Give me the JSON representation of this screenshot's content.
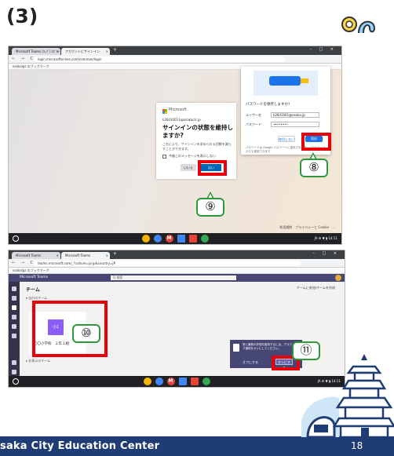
{
  "step_number": "(3)",
  "screenshot1": {
    "tabs": [
      "Microsoft Teams (ｳｪﾌﾞ) ﾛｸﾞｲﾝ",
      "アカウントにサインイン"
    ],
    "new_tab": "+",
    "window_controls": "– □ ×",
    "nav_buttons": "← → C",
    "url": "login.microsoftonline.com/common/login",
    "bookmarks_bar": "osakalgs のブックマーク",
    "dialog": {
      "brand": "Microsoft",
      "email": "k26d10011@osakaclc.jp",
      "title": "サインインの状態を維持しますか?",
      "description": "これにより、サインインを求められる回数を減らすことができます。",
      "checkbox_label": "今後このメッセージを表示しない",
      "no_button": "いいえ",
      "yes_button": "はい"
    },
    "password_panel": {
      "title": "パスワードを保存しますか?",
      "username_label": "ユーザー名",
      "username_value": "k26d1001@osaka.jp",
      "password_label": "パスワード",
      "password_value": "••••••••",
      "never_button": "使用しない",
      "save_button": "保存",
      "note": "パスワードは Google パスワードに保存されます。このデバイスからも使用できます"
    },
    "footer": "利用規約　プライバシーと Cookie　…",
    "tray_time": "JA ⚙ ▼ ▮ 14:11",
    "callouts": [
      "⑨",
      "⑧"
    ]
  },
  "screenshot2": {
    "tabs": [
      "Microsoft Teams",
      "Microsoft Teams"
    ],
    "url": "teams.microsoft.com/_?culture=ja-jp&country=JP",
    "bookmarks_bar": "osakalgs のブックマーク",
    "app_title": "Microsoft Teams",
    "search_placeholder": "Q 検索",
    "heading": "チーム",
    "section_label": "▾ 自分のチーム",
    "hidden_section_label": "▸ 非表示のチーム",
    "join_label": "チームに参加/チームを作成",
    "team_tile_text": "小1",
    "team_name": "〇〇小学校　２年１組",
    "notification": {
      "text": "常に最新の状態を維持するには、デスクトップ通知をオンにしてください。",
      "later": "オフにする",
      "ok": "オンにする"
    },
    "tray_time": "JA ⚙ ▼ ▮ 14:11",
    "callouts": [
      "⑩",
      "⑪"
    ]
  },
  "footer": {
    "org": "saka City Education Center",
    "page_number": "18"
  },
  "colors": {
    "highlight": "#e8000b",
    "callout_border": "#2c9a3a",
    "band": "#1f3c74",
    "teams": "#464775",
    "ms_blue": "#0067b8"
  }
}
